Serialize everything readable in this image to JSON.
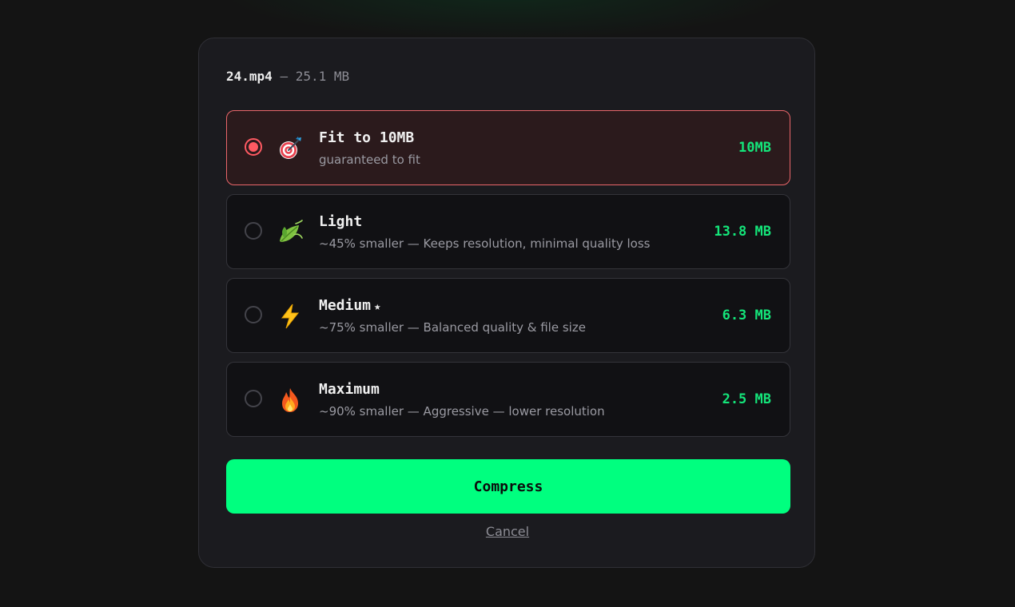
{
  "file": {
    "name": "24.mp4",
    "separator": "—",
    "size": "25.1 MB"
  },
  "options": [
    {
      "title": "Fit to 10MB",
      "description": "guaranteed to fit",
      "output_size": "10MB",
      "icon": "target-icon",
      "selected": true
    },
    {
      "title": "Light",
      "description": "~45% smaller — Keeps resolution, minimal quality loss",
      "output_size": "13.8 MB",
      "icon": "leaf-icon",
      "selected": false
    },
    {
      "title": "Medium",
      "badge": "★",
      "description": "~75% smaller — Balanced quality & file size",
      "output_size": "6.3 MB",
      "icon": "lightning-icon",
      "selected": false
    },
    {
      "title": "Maximum",
      "description": "~90% smaller — Aggressive — lower resolution",
      "output_size": "2.5 MB",
      "icon": "fire-icon",
      "selected": false
    }
  ],
  "actions": {
    "compress_label": "Compress",
    "cancel_label": "Cancel"
  },
  "colors": {
    "accent_green": "#00ff7f",
    "size_green": "#14e57a",
    "selected_red": "#ff5a62",
    "panel_bg": "#1b1b1f"
  }
}
